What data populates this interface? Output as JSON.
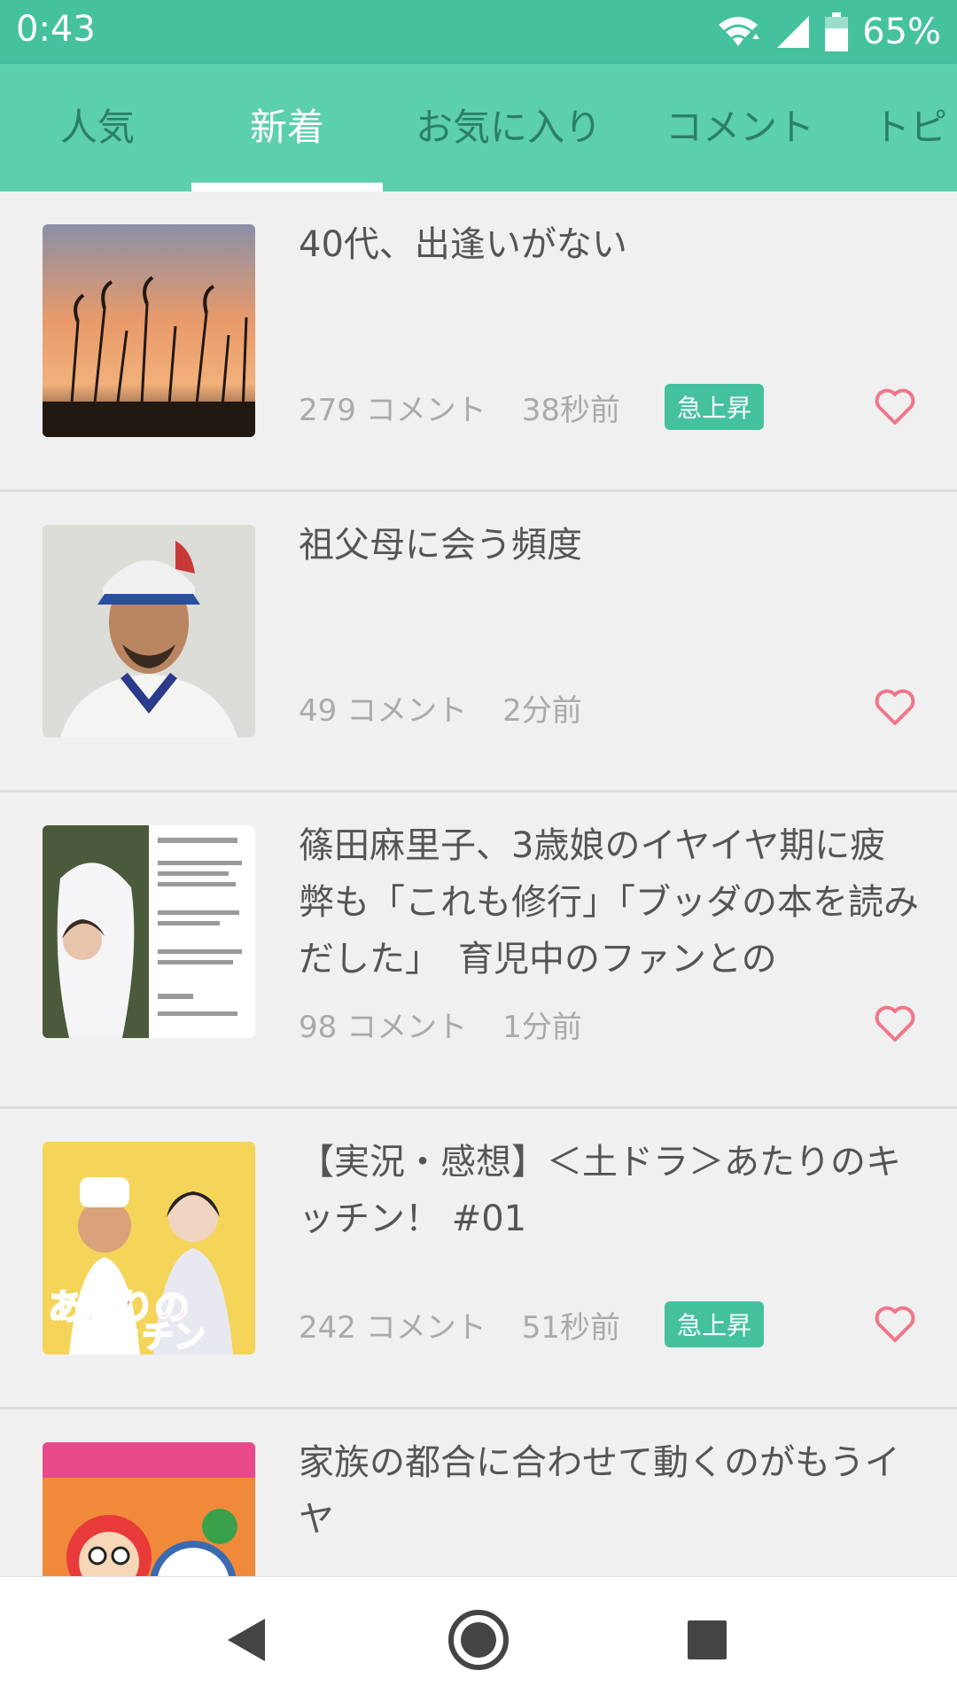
{
  "status_bar": {
    "time": "0:43",
    "battery": "65%",
    "icons": [
      "wifi-icon",
      "signal-icon",
      "battery-icon"
    ]
  },
  "tabs": [
    {
      "label": "人気"
    },
    {
      "label": "新着",
      "active": true
    },
    {
      "label": "お気に入り"
    },
    {
      "label": "コメント"
    },
    {
      "label": "トピ"
    }
  ],
  "topics": [
    {
      "title": "40代、出逢いがない",
      "comments": "279 コメント",
      "time_ago": "38秒前",
      "badge": "急上昇"
    },
    {
      "title": "祖父母に会う頻度",
      "comments": "49 コメント",
      "time_ago": "2分前",
      "badge": ""
    },
    {
      "title": "篠田麻里子、3歳娘のイヤイヤ期に疲弊も「これも修行」「ブッダの本を読みだした」　育児中のファンとの",
      "comments": "98 コメント",
      "time_ago": "1分前",
      "badge": ""
    },
    {
      "title": "【実況・感想】＜土ドラ＞あたりのキッチン！ #01",
      "comments": "242 コメント",
      "time_ago": "51秒前",
      "badge": "急上昇"
    },
    {
      "title": "家族の都合に合わせて動くのがもうイヤ",
      "comments": "",
      "time_ago": "",
      "badge": ""
    }
  ],
  "nav": {
    "icons": [
      "back-icon",
      "home-icon",
      "recents-icon"
    ]
  },
  "colors": {
    "accent": "#45c19e",
    "tab_bar": "#5ccfad",
    "heart": "#f0768a"
  }
}
